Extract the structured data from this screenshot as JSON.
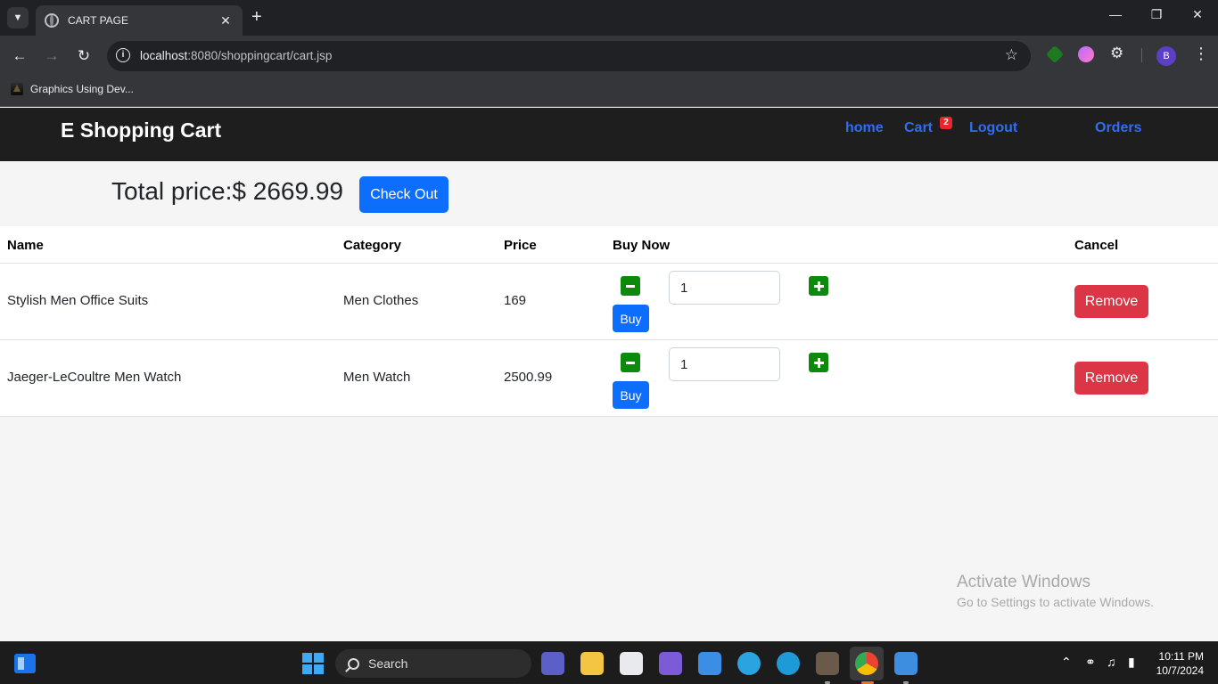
{
  "browser": {
    "tab_title": "CART PAGE",
    "url_host": "localhost",
    "url_rest": ":8080/shoppingcart/cart.jsp",
    "bookmark_label": "Graphics Using Dev...",
    "profile_initial": "B"
  },
  "navbar": {
    "brand": "E Shopping Cart",
    "links": {
      "home": "home",
      "cart": "Cart",
      "logout": "Logout",
      "orders": "Orders"
    },
    "cart_count": "2",
    "link_color": "#2f6df6"
  },
  "summary": {
    "total_label": "Total price:$ 2669.99",
    "checkout_label": "Check Out"
  },
  "table": {
    "headers": {
      "name": "Name",
      "category": "Category",
      "price": "Price",
      "buy_now": "Buy Now",
      "cancel": "Cancel"
    },
    "rows": [
      {
        "name": "Stylish Men Office Suits",
        "category": "Men Clothes",
        "price": "169",
        "quantity": "1",
        "buy_label": "Buy",
        "remove_label": "Remove"
      },
      {
        "name": "Jaeger-LeCoultre Men Watch",
        "category": "Men Watch",
        "price": "2500.99",
        "quantity": "1",
        "buy_label": "Buy",
        "remove_label": "Remove"
      }
    ]
  },
  "watermark": {
    "line1": "Activate Windows",
    "line2": "Go to Settings to activate Windows."
  },
  "taskbar": {
    "search_label": "Search",
    "time": "10:11 PM",
    "date": "10/7/2024"
  },
  "colors": {
    "primary": "#0d6efd",
    "danger": "#dc3545",
    "qty_green": "#0b8a0b",
    "navbar_bg": "#1e1e1e"
  }
}
